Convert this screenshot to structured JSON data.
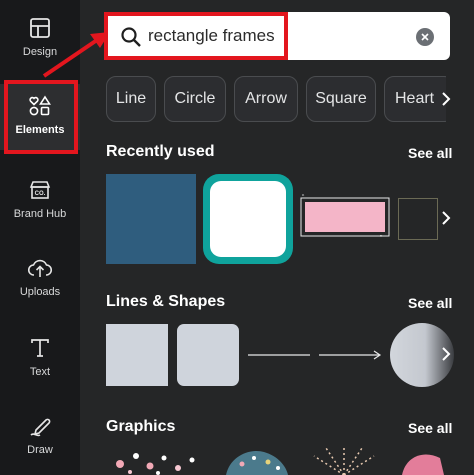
{
  "sidebar": {
    "items": [
      {
        "label": "Design",
        "icon": "layout-icon"
      },
      {
        "label": "Elements",
        "icon": "shapes-icon",
        "active": true
      },
      {
        "label": "Brand Hub",
        "icon": "brand-hub-icon"
      },
      {
        "label": "Uploads",
        "icon": "cloud-upload-icon"
      },
      {
        "label": "Text",
        "icon": "text-icon"
      },
      {
        "label": "Draw",
        "icon": "draw-icon"
      }
    ]
  },
  "search": {
    "value": "rectangle frames",
    "placeholder": ""
  },
  "chips": [
    "Line",
    "Circle",
    "Arrow",
    "Square",
    "Heart"
  ],
  "sections": {
    "recently_used": {
      "title": "Recently used",
      "see_all": "See all"
    },
    "lines_shapes": {
      "title": "Lines & Shapes",
      "see_all": "See all"
    },
    "graphics": {
      "title": "Graphics",
      "see_all": "See all"
    }
  },
  "colors": {
    "highlight": "#e3161e",
    "blue_square": "#2f5d7e",
    "teal_frame": "#0fa39c",
    "pink_rect": "#f4b5c8",
    "shape_gray": "#cfd4dc"
  }
}
